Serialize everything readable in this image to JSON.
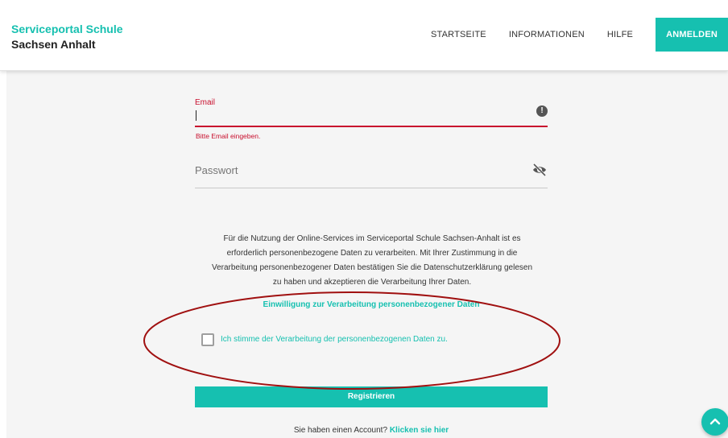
{
  "header": {
    "brand_line1": "Serviceportal Schule",
    "brand_line2": "Sachsen Anhalt",
    "nav": [
      {
        "label": "STARTSEITE"
      },
      {
        "label": "INFORMATIONEN"
      },
      {
        "label": "HILFE"
      },
      {
        "label": "ANMELDEN",
        "active": true
      }
    ]
  },
  "form": {
    "email": {
      "label": "Email",
      "value": "",
      "error": "Bitte Email eingeben.",
      "icon": "alert-icon"
    },
    "password": {
      "placeholder": "Passwort",
      "icon": "eye-off-icon"
    },
    "info_lines": [
      "Für die Nutzung der Online-Services im Serviceportal Schule Sachsen-Anhalt ist es",
      "erforderlich personenbezogene Daten zu verarbeiten. Mit Ihrer Zustimmung in die",
      "Verarbeitung personenbezogener Daten bestätigen Sie die Datenschutzerklärung gelesen",
      "zu haben und akzeptieren die Verarbeitung Ihrer Daten."
    ],
    "consent_heading": "Einwilligung zur Verarbeitung personenbezogener Daten",
    "consent_checkbox_label": "Ich stimme der Verarbeitung der personenbezogenen Daten zu.",
    "consent_checked": false,
    "register_label": "Registrieren",
    "account_prompt": "Sie haben einen Account?",
    "account_link": "Klicken sie hier"
  },
  "colors": {
    "accent": "#16c0b0",
    "error": "#c8102e",
    "annotation": "#a01010",
    "background": "#f5f5f5"
  },
  "scroll_top_icon": "chevron-up-icon"
}
